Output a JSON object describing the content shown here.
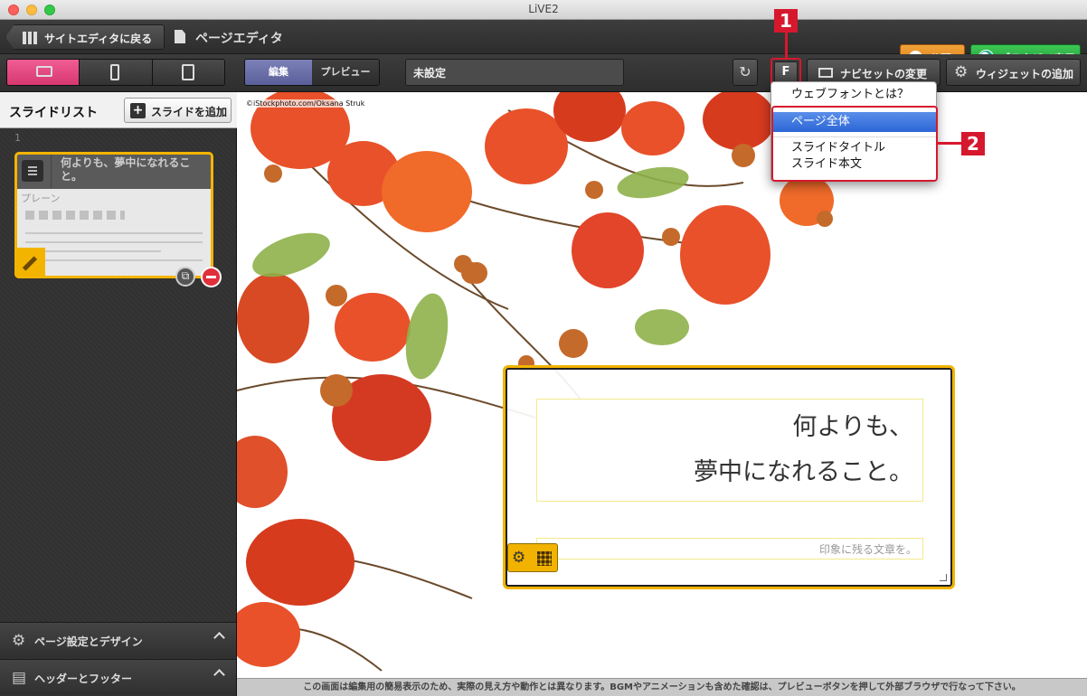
{
  "window": {
    "title": "LiVE2"
  },
  "header": {
    "back_label": "サイトエディタに戻る",
    "page_title": "ページエディタ",
    "publish_label": "公開",
    "browser_label": "ブラウザで表示"
  },
  "toolbar": {
    "modes": [
      "編集",
      "プレビュー"
    ],
    "slide_name": "未設定",
    "font_button": "F",
    "navset_label": "ナビセットの変更",
    "widget_label": "ウィジェットの追加"
  },
  "sidebar": {
    "title": "スライドリスト",
    "add_slide": "スライドを追加",
    "slide_number": "1",
    "slide_title": "何よりも、夢中になれること。",
    "slide_type": "プレーン",
    "panels": [
      "ページ設定とデザイン",
      "ヘッダーとフッター"
    ]
  },
  "canvas": {
    "photo_credit": "©iStockphoto.com/Oksana Struk",
    "title_lines": [
      "何よりも、",
      "夢中になれること。"
    ],
    "body_text": "印象に残る文章を。"
  },
  "font_menu": {
    "items": [
      "ウェブフォントとは？",
      "ページ全体",
      "スライドタイトル",
      "スライド本文"
    ],
    "selected": "ページ全体"
  },
  "markers": [
    "1",
    "2"
  ],
  "footer_note": "この画面は編集用の簡易表示のため、実際の見え方や動作とは異なります。BGMやアニメーションも含めた確認は、プレビューボタンを押して外部ブラウザで行なって下さい。",
  "colors": {
    "accent_pink": "#e14a83",
    "highlight_yellow": "#f2b300",
    "marker_red": "#d6182e",
    "publish_orange": "#e8901c",
    "browser_green": "#2cb544"
  }
}
